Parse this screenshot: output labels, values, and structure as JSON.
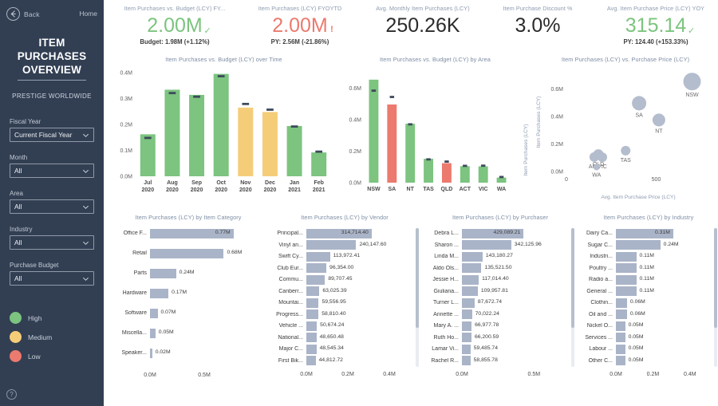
{
  "sidebar": {
    "back_label": "Back",
    "home_label": "Home",
    "page_title": "ITEM PURCHASES OVERVIEW",
    "company": "PRESTIGE WORLDWIDE",
    "slicers": [
      {
        "label": "Fiscal Year",
        "value": "Current Fiscal Year"
      },
      {
        "label": "Month",
        "value": "All"
      },
      {
        "label": "Area",
        "value": "All"
      },
      {
        "label": "Industry",
        "value": "All"
      },
      {
        "label": "Purchase Budget",
        "value": "All"
      }
    ],
    "legend": [
      {
        "label": "High",
        "color": "#7cc47f"
      },
      {
        "label": "Medium",
        "color": "#f5cd79"
      },
      {
        "label": "Low",
        "color": "#ec7a6e"
      }
    ],
    "help_glyph": "?",
    "bg_color": "#323f53"
  },
  "kpis": [
    {
      "title": "Item Purchases vs. Budget (LCY) FY...",
      "value": "2.00M",
      "value_color": "green",
      "flag": "✓",
      "flag_type": "tick",
      "subtitle": "Budget: 1.98M (+1.12%)"
    },
    {
      "title": "Item Purchases (LCY) FYOYTD",
      "value": "2.00M",
      "value_color": "red",
      "flag": "!",
      "flag_type": "bang",
      "subtitle": "PY: 2.56M (-21.86%)"
    },
    {
      "title": "Avg. Monthly Item Purchases (LCY)",
      "value": "250.26K",
      "value_color": "dark",
      "flag": "",
      "flag_type": "none",
      "subtitle": ""
    },
    {
      "title": "Item Purchase Discount %",
      "value": "3.0%",
      "value_color": "dark",
      "flag": "",
      "flag_type": "none",
      "subtitle": ""
    },
    {
      "title": "Avg. Item Purchase Price (LCY) YOY",
      "value": "315.14",
      "value_color": "green",
      "flag": "✓",
      "flag_type": "tick",
      "subtitle": "PY: 124.40 (+153.33%)"
    }
  ],
  "chart_data": [
    {
      "id": "purchases_over_time",
      "type": "bar",
      "title": "Item Purchases vs. Budget (LCY) over Time",
      "xlabel": "",
      "ylabel": "",
      "ylim": [
        0,
        0.4
      ],
      "yticks": [
        "0.0M",
        "0.1M",
        "0.2M",
        "0.3M",
        "0.4M"
      ],
      "ytick_values": [
        0.0,
        0.1,
        0.2,
        0.3,
        0.4
      ],
      "categories": [
        "Jul 2020",
        "Aug 2020",
        "Sep 2020",
        "Oct 2020",
        "Nov 2020",
        "Dec 2020",
        "Jan 2021",
        "Feb 2021"
      ],
      "values": [
        0.162,
        0.334,
        0.314,
        0.395,
        0.265,
        0.248,
        0.194,
        0.092
      ],
      "budget_markers": [
        0.148,
        0.321,
        0.307,
        0.386,
        0.279,
        0.257,
        0.192,
        0.095
      ],
      "bar_colors": [
        "#7cc47f",
        "#7cc47f",
        "#7cc47f",
        "#7cc47f",
        "#f5cd79",
        "#f5cd79",
        "#7cc47f",
        "#7cc47f"
      ],
      "marker_color": "#3d4a5c",
      "grid": false
    },
    {
      "id": "purchases_by_area",
      "type": "bar",
      "title": "Item Purchases vs. Budget (LCY) by Area",
      "xlabel": "",
      "ylabel": "",
      "ylim": [
        0,
        0.7
      ],
      "yticks": [
        "0.0M",
        "0.2M",
        "0.4M",
        "0.6M"
      ],
      "ytick_values": [
        0.0,
        0.2,
        0.4,
        0.6
      ],
      "categories": [
        "NSW",
        "SA",
        "NT",
        "TAS",
        "QLD",
        "ACT",
        "VIC",
        "WA"
      ],
      "values": [
        0.655,
        0.497,
        0.375,
        0.152,
        0.124,
        0.105,
        0.104,
        0.032
      ],
      "budget_markers": [
        0.585,
        0.545,
        0.371,
        0.148,
        0.134,
        0.107,
        0.108,
        0.036
      ],
      "bar_colors": [
        "#7cc47f",
        "#ec7a6e",
        "#7cc47f",
        "#7cc47f",
        "#ec7a6e",
        "#7cc47f",
        "#7cc47f",
        "#7cc47f"
      ],
      "marker_color": "#3d4a5c",
      "grid": false
    },
    {
      "id": "purchases_vs_price",
      "type": "scatter",
      "title": "Item Purchases (LCY) vs. Purchase Price (LCY)",
      "xlabel": "Avg. Item Purchase Price (LCY)",
      "ylabel": "Item Purchases (LCY)",
      "xlim": [
        0,
        800
      ],
      "ylim": [
        0,
        0.72
      ],
      "xticks": [
        "0",
        "500"
      ],
      "xtick_values": [
        0,
        500
      ],
      "yticks": [
        "0.0M",
        "0.2M",
        "0.4M",
        "0.6M"
      ],
      "ytick_values": [
        0.0,
        0.2,
        0.4,
        0.6
      ],
      "point_color": "#b4bdcd",
      "points": [
        {
          "label": "NSW",
          "x": 700,
          "y": 0.655,
          "r": 11
        },
        {
          "label": "SA",
          "x": 405,
          "y": 0.497,
          "r": 9
        },
        {
          "label": "NT",
          "x": 515,
          "y": 0.375,
          "r": 8
        },
        {
          "label": "TAS",
          "x": 330,
          "y": 0.152,
          "r": 6
        },
        {
          "label": "ACT",
          "x": 155,
          "y": 0.105,
          "r": 6
        },
        {
          "label": "VIC",
          "x": 200,
          "y": 0.104,
          "r": 6
        },
        {
          "label": "QLD",
          "x": 178,
          "y": 0.124,
          "r": 6.5
        },
        {
          "label": "WA",
          "x": 168,
          "y": 0.032,
          "r": 4
        }
      ]
    },
    {
      "id": "purchases_by_item_category",
      "type": "bar",
      "orientation": "horizontal",
      "title": "Item Purchases (LCY) by Item Category",
      "xlim": [
        0,
        1.0
      ],
      "xticks": [
        "0.0M",
        "0.5M"
      ],
      "xtick_values": [
        0.0,
        0.5
      ],
      "bar_color": "#aab4c8",
      "categories": [
        "Office F...",
        "Retail",
        "Parts",
        "Hardware",
        "Software",
        "Miscella...",
        "Speaker..."
      ],
      "values": [
        0.77,
        0.68,
        0.24,
        0.17,
        0.07,
        0.05,
        0.02
      ],
      "value_labels": [
        "0.77M",
        "0.68M",
        "0.24M",
        "0.17M",
        "0.07M",
        "0.05M",
        "0.02M"
      ],
      "scrollable": false
    },
    {
      "id": "purchases_by_vendor",
      "type": "bar",
      "orientation": "horizontal",
      "title": "Item Purchases (LCY) by Vendor",
      "xlim": [
        0,
        0.5
      ],
      "xticks": [
        "0.0M",
        "0.2M",
        "0.4M"
      ],
      "xtick_values": [
        0.0,
        0.2,
        0.4
      ],
      "bar_color": "#aab4c8",
      "categories": [
        "Principal...",
        "Vinyl an...",
        "Swift Cy...",
        "Club Eur...",
        "Commu...",
        "Canberr...",
        "Mountai...",
        "Progress...",
        "Vehicle ...",
        "National...",
        "Major C...",
        "First Bik..."
      ],
      "values": [
        314714.4,
        240147.6,
        113972.41,
        96354.0,
        89707.45,
        63025.39,
        59556.95,
        58810.4,
        50674.24,
        48650.48,
        48545.34,
        44812.72
      ],
      "value_labels": [
        "314,714.40",
        "240,147.60",
        "113,972.41",
        "96,354.00",
        "89,707.45",
        "63,025.39",
        "59,556.95",
        "58,810.40",
        "50,674.24",
        "48,650.48",
        "48,545.34",
        "44,812.72"
      ],
      "scrollable": true
    },
    {
      "id": "purchases_by_purchaser",
      "type": "bar",
      "orientation": "horizontal",
      "title": "Item Purchases (LCY) by Purchaser",
      "xlim": [
        0,
        0.72
      ],
      "xticks": [
        "0.0M",
        "0.5M"
      ],
      "xtick_values": [
        0.0,
        0.5
      ],
      "bar_color": "#aab4c8",
      "categories": [
        "Debra L...",
        "Sharon ...",
        "Linda M...",
        "Aldo Ols...",
        "Jessie H...",
        "Giuliana...",
        "Turner L...",
        "Annette ...",
        "Mary A. ...",
        "Ruth Ho...",
        "Lamar Vi...",
        "Rachel R..."
      ],
      "values": [
        429089.21,
        342125.96,
        143180.27,
        135521.5,
        117014.4,
        109957.81,
        87672.74,
        70022.24,
        66977.78,
        66200.59,
        59485.74,
        58855.78
      ],
      "value_labels": [
        "429,089.21",
        "342,125.96",
        "143,180.27",
        "135,521.50",
        "117,014.40",
        "109,957.81",
        "87,672.74",
        "70,022.24",
        "66,977.78",
        "66,200.59",
        "59,485.74",
        "58,855.78"
      ],
      "scrollable": true
    },
    {
      "id": "purchases_by_industry",
      "type": "bar",
      "orientation": "horizontal",
      "title": "Item Purchases (LCY) by Industry",
      "xlim": [
        0,
        0.5
      ],
      "xticks": [
        "0.0M",
        "0.2M",
        "0.4M"
      ],
      "xtick_values": [
        0.0,
        0.2,
        0.4
      ],
      "bar_color": "#aab4c8",
      "categories": [
        "Dairy Ca...",
        "Sugar C...",
        "Industri...",
        "Poultry ...",
        "Radio a...",
        "General ...",
        "Clothin...",
        "Oil and ...",
        "Nickel O...",
        "Services ...",
        "Labour ...",
        "Other C..."
      ],
      "values": [
        0.31,
        0.24,
        0.11,
        0.11,
        0.11,
        0.11,
        0.06,
        0.06,
        0.05,
        0.05,
        0.05,
        0.05
      ],
      "value_labels": [
        "0.31M",
        "0.24M",
        "0.11M",
        "0.11M",
        "0.11M",
        "0.11M",
        "0.06M",
        "0.06M",
        "0.05M",
        "0.05M",
        "0.05M",
        "0.05M"
      ],
      "scrollable": true
    }
  ]
}
